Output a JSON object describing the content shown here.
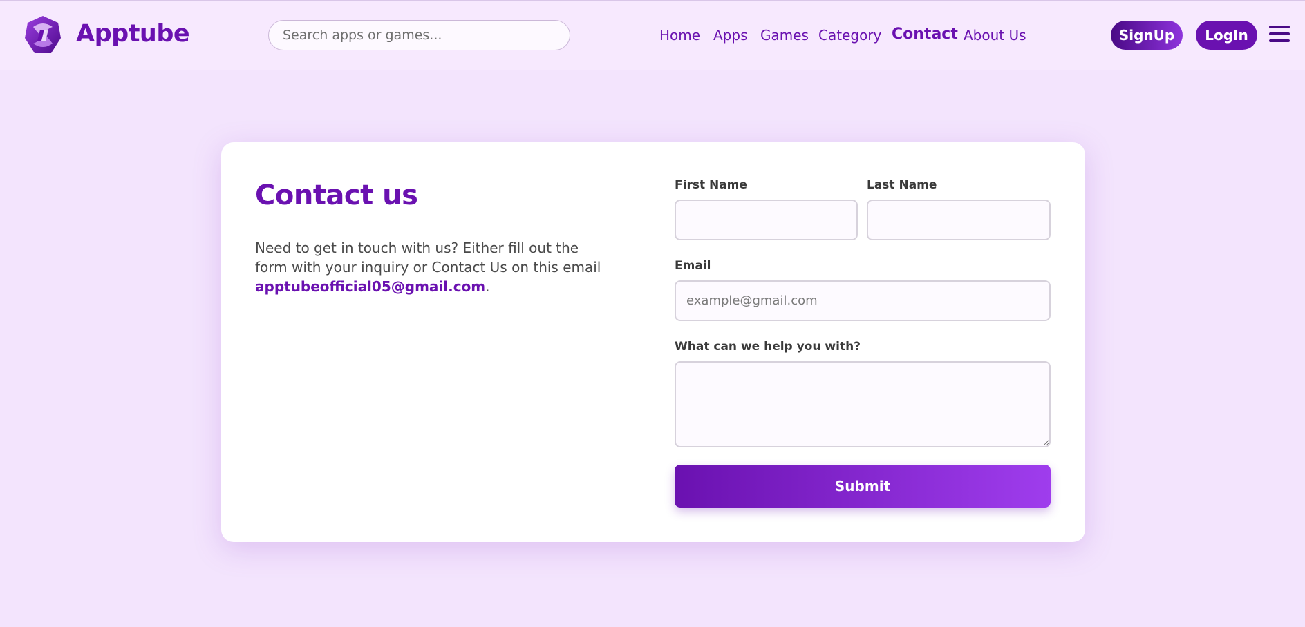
{
  "header": {
    "brand": "Apptube",
    "search_placeholder": "Search apps or games...",
    "nav": [
      {
        "label": "Home"
      },
      {
        "label": "Apps"
      },
      {
        "label": "Games"
      },
      {
        "label": "Category"
      },
      {
        "label": "Contact",
        "active": true
      },
      {
        "label": "About Us"
      }
    ],
    "signup_label": "SignUp",
    "login_label": "LogIn"
  },
  "contact": {
    "title": "Contact us",
    "text_before": "Need to get in touch with us? Either fill out the form with your inquiry or Contact Us on this email ",
    "email": "apptubeofficial05@gmail.com",
    "text_after": "."
  },
  "form": {
    "first_name_label": "First Name",
    "last_name_label": "Last Name",
    "email_label": "Email",
    "email_placeholder": "example@gmail.com",
    "message_label": "What can we help you with?",
    "submit_label": "Submit"
  },
  "colors": {
    "brand": "#6a11b0",
    "page_bg": "#f3e4fd",
    "header_bg": "#f7e9fe"
  }
}
